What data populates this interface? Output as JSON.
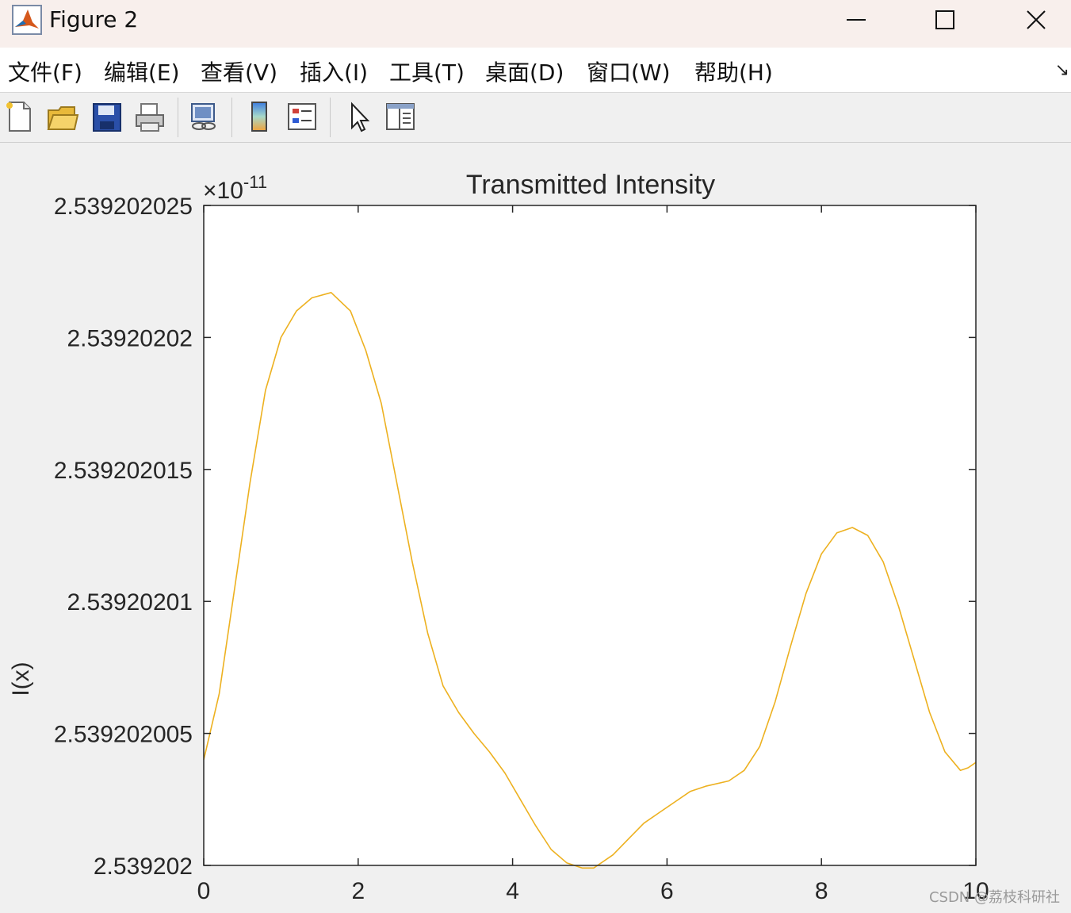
{
  "window": {
    "title": "Figure 2"
  },
  "menu": {
    "items": [
      "文件(F)",
      "编辑(E)",
      "查看(V)",
      "插入(I)",
      "工具(T)",
      "桌面(D)",
      "窗口(W)",
      "帮助(H)"
    ]
  },
  "toolbar": {
    "icons": [
      "new-figure-icon",
      "open-file-icon",
      "save-icon",
      "print-icon",
      "link-plot-icon",
      "colorbar-icon",
      "legend-icon",
      "pointer-icon",
      "property-editor-icon"
    ]
  },
  "watermark": "CSDN @荔枝科研社",
  "colors": {
    "line": "#edb120",
    "axes_bg": "#ffffff",
    "figure_bg": "#f0f0f0"
  },
  "chart_data": {
    "type": "line",
    "title": "Transmitted Intensity",
    "xlabel": "",
    "ylabel": "I(x)",
    "y_exponent_label": "×10",
    "y_exponent_power": "-11",
    "xlim": [
      0,
      10
    ],
    "ylim": [
      2.539202,
      2.539202025
    ],
    "x_ticks": [
      0,
      2,
      4,
      6,
      8,
      10
    ],
    "x_tick_labels": [
      "0",
      "2",
      "4",
      "6",
      "8",
      "10"
    ],
    "y_ticks": [
      2.539202,
      2.539202005,
      2.53920201,
      2.539202015,
      2.53920202,
      2.539202025
    ],
    "y_tick_labels": [
      "2.539202",
      "2.539202005",
      "2.53920201",
      "2.539202015",
      "2.53920202",
      "2.539202025"
    ],
    "grid": false,
    "series": [
      {
        "color": "#edb120",
        "x": [
          0,
          0.2,
          0.4,
          0.6,
          0.8,
          1.0,
          1.2,
          1.4,
          1.65,
          1.9,
          2.1,
          2.3,
          2.5,
          2.7,
          2.9,
          3.1,
          3.3,
          3.5,
          3.7,
          3.9,
          4.1,
          4.3,
          4.5,
          4.7,
          4.9,
          5.05,
          5.3,
          5.5,
          5.7,
          5.9,
          6.1,
          6.3,
          6.5,
          6.8,
          7.0,
          7.2,
          7.4,
          7.6,
          7.8,
          8.0,
          8.2,
          8.4,
          8.6,
          8.8,
          9.0,
          9.2,
          9.4,
          9.6,
          9.8,
          9.9,
          10.0
        ],
        "y": [
          2.539202004,
          2.5392020065,
          2.5392020105,
          2.5392020145,
          2.539202018,
          2.53920202,
          2.539202021,
          2.5392020215,
          2.5392020217,
          2.539202021,
          2.5392020195,
          2.5392020175,
          2.5392020145,
          2.5392020115,
          2.5392020088,
          2.5392020068,
          2.5392020058,
          2.539202005,
          2.5392020043,
          2.5392020035,
          2.5392020025,
          2.5392020015,
          2.5392020006,
          2.5392020001,
          2.5392019999,
          2.5392019999,
          2.5392020004,
          2.539202001,
          2.5392020016,
          2.539202002,
          2.5392020024,
          2.5392020028,
          2.539202003,
          2.5392020032,
          2.5392020036,
          2.5392020045,
          2.5392020062,
          2.5392020083,
          2.5392020103,
          2.5392020118,
          2.5392020126,
          2.5392020128,
          2.5392020125,
          2.5392020115,
          2.5392020098,
          2.5392020078,
          2.5392020058,
          2.5392020043,
          2.5392020036,
          2.5392020037,
          2.5392020039
        ]
      }
    ]
  }
}
